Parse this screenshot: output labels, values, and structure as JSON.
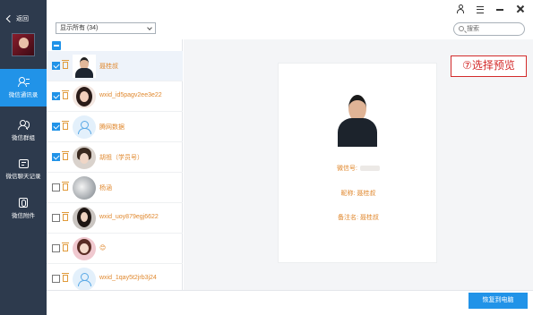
{
  "sidebar": {
    "back_label": "返回",
    "items": [
      {
        "label": "微信通讯录",
        "icon": "contacts-icon",
        "active": true
      },
      {
        "label": "微信群组",
        "icon": "group-icon",
        "active": false
      },
      {
        "label": "微信聊天记录",
        "icon": "chat-record-icon",
        "active": false
      },
      {
        "label": "微信附件",
        "icon": "attachment-icon",
        "active": false
      }
    ]
  },
  "toolbar": {
    "filter_value": "显示所有 (34)",
    "search_placeholder": "搜索"
  },
  "contacts": [
    {
      "name": "聂桂叔",
      "checked": true,
      "avatar": "man-photo"
    },
    {
      "name": "wxid_id5pagv2ee3e22",
      "checked": true,
      "avatar": "girl-photo"
    },
    {
      "name": "腾网数据",
      "checked": true,
      "avatar": "default-avatar"
    },
    {
      "name": "胡祖（学员号）",
      "checked": true,
      "avatar": "girl-photo"
    },
    {
      "name": "杨涵",
      "checked": false,
      "avatar": "blurred-photo"
    },
    {
      "name": "wxid_uoy879egj6622",
      "checked": false,
      "avatar": "girl-photo"
    },
    {
      "name": "😊",
      "checked": false,
      "avatar": "girl-photo"
    },
    {
      "name": "wxid_1qay5t2jrb3j24",
      "checked": false,
      "avatar": "default-avatar"
    }
  ],
  "preview": {
    "wechat_id_label": "微信号:",
    "nickname_line": "昵称: 聂桂叔",
    "remark_line": "备注名: 聂桂叔"
  },
  "annotation": "⑦选择预览",
  "restore_button": "恢复到电脑",
  "colors": {
    "accent": "#2193e8",
    "sidebar": "#2d3a4d",
    "name_text": "#e0882e",
    "annotation": "#d32b2b"
  }
}
